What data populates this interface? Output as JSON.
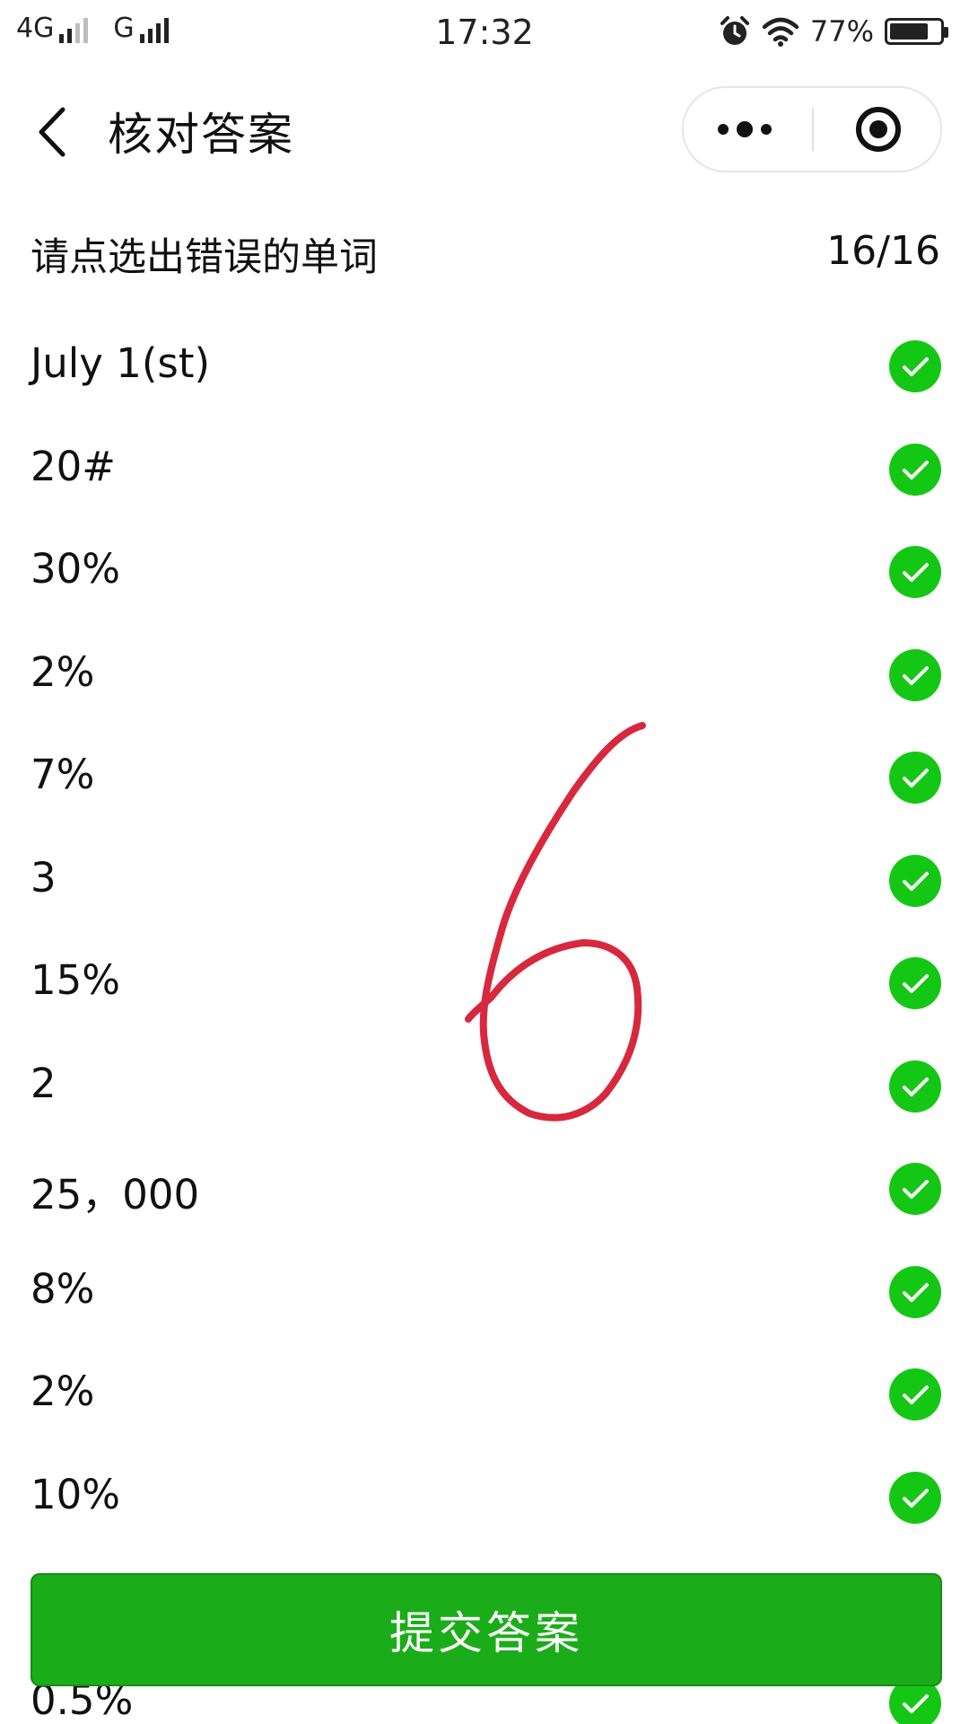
{
  "status_bar": {
    "network_primary": "4G",
    "network_secondary": "G",
    "time": "17:32",
    "battery_percent": "77%",
    "battery_level": 0.77
  },
  "nav": {
    "title": "核对答案",
    "back_icon": "chevron-left-icon",
    "more_icon": "more-dots-icon",
    "close_icon": "target-circle-icon"
  },
  "header": {
    "instruction": "请点选出错误的单词",
    "progress": "16/16"
  },
  "answers": [
    {
      "text": "July 1(st)",
      "status": "correct"
    },
    {
      "text": "20#",
      "status": "correct"
    },
    {
      "text": "30%",
      "status": "correct"
    },
    {
      "text": "2%",
      "status": "correct"
    },
    {
      "text": "7%",
      "status": "correct"
    },
    {
      "text": "3",
      "status": "correct"
    },
    {
      "text": "15%",
      "status": "correct"
    },
    {
      "text": "2",
      "status": "correct"
    },
    {
      "text": "25，000",
      "status": "correct"
    },
    {
      "text": "8%",
      "status": "correct"
    },
    {
      "text": "2%",
      "status": "correct"
    },
    {
      "text": "10%",
      "status": "correct"
    },
    {
      "text": "",
      "status": "correct"
    },
    {
      "text": "0.5%",
      "status": "correct"
    }
  ],
  "submit_label": "提交答案",
  "colors": {
    "accent_green": "#1aad19",
    "check_green": "#15c715",
    "annotation_red": "#d8283e"
  }
}
